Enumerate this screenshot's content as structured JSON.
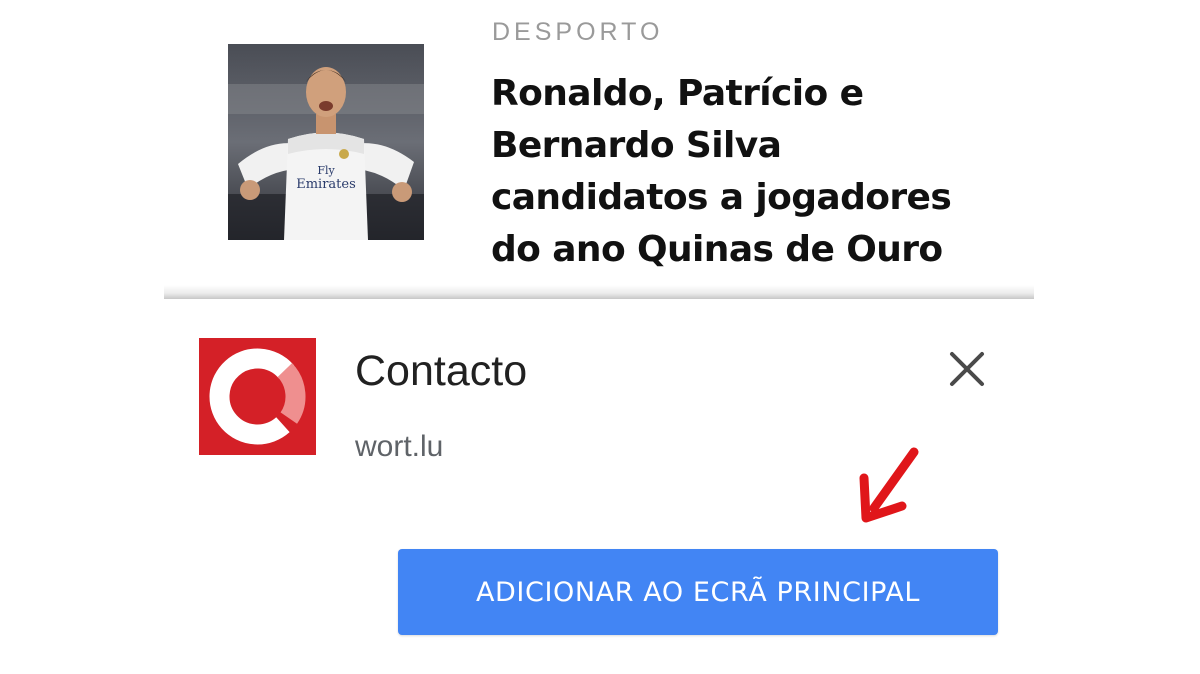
{
  "article": {
    "category": "DESPORTO",
    "headline": "Ronaldo, Patrício e Bernardo Silva candidatos a jogadores do ano Quinas de Ouro",
    "thumbnail_icon": "football-player-photo"
  },
  "install_prompt": {
    "app_name": "Contacto",
    "app_url": "wort.lu",
    "app_icon": "contacto-logo-icon",
    "close_icon": "close-icon",
    "add_button_label": "ADICIONAR AO ECRÃ PRINCIPAL",
    "annotation_icon": "red-arrow-icon"
  },
  "colors": {
    "button": "#4285f4",
    "logo_red": "#d42027",
    "arrow_red": "#e0161a",
    "category_gray": "#9a9a9a"
  }
}
